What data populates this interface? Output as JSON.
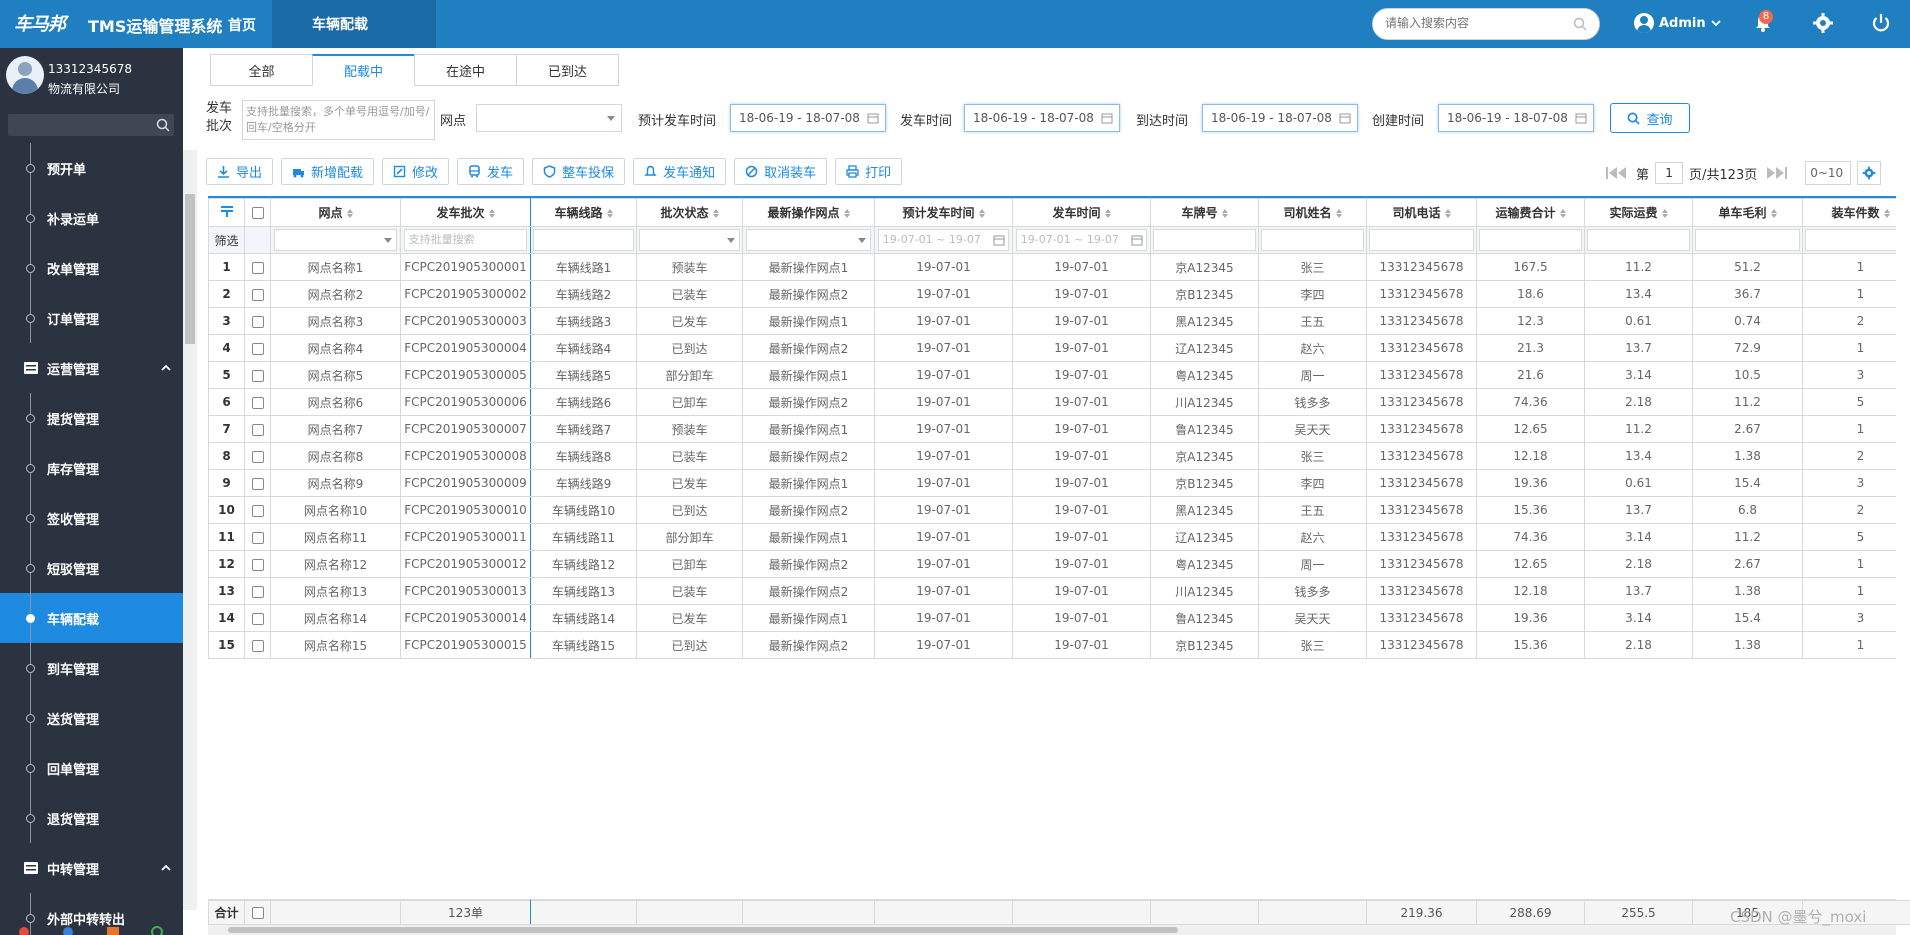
{
  "header": {
    "logo_text": "车马邦",
    "app_title": "TMS运输管理系统",
    "home": "首页",
    "active_tab": "车辆配载",
    "search_placeholder": "请输入搜索内容",
    "user": "Admin",
    "notification_count": "8"
  },
  "sidebar": {
    "phone": "13312345678",
    "company": "物流有限公司",
    "items": [
      {
        "label": "预开单",
        "type": "item"
      },
      {
        "label": "补录运单",
        "type": "item"
      },
      {
        "label": "改单管理",
        "type": "item"
      },
      {
        "label": "订单管理",
        "type": "item"
      },
      {
        "label": "运营管理",
        "type": "group"
      },
      {
        "label": "提货管理",
        "type": "item"
      },
      {
        "label": "库存管理",
        "type": "item"
      },
      {
        "label": "签收管理",
        "type": "item"
      },
      {
        "label": "短驳管理",
        "type": "item"
      },
      {
        "label": "车辆配载",
        "type": "item",
        "active": true
      },
      {
        "label": "到车管理",
        "type": "item"
      },
      {
        "label": "送货管理",
        "type": "item"
      },
      {
        "label": "回单管理",
        "type": "item"
      },
      {
        "label": "退货管理",
        "type": "item"
      },
      {
        "label": "中转管理",
        "type": "group"
      },
      {
        "label": "外部中转转出",
        "type": "item"
      }
    ]
  },
  "tabs": [
    "全部",
    "配载中",
    "在途中",
    "已到达"
  ],
  "active_tab_index": 1,
  "filters": {
    "batch_label": "发车批次",
    "batch_placeholder": "支持批量搜索，多个单号用逗号/加号/回车/空格分开",
    "site_label": "网点",
    "est_depart_label": "预计发车时间",
    "est_depart_value": "18-06-19 - 18-07-08",
    "depart_label": "发车时间",
    "depart_value": "18-06-19 - 18-07-08",
    "arrive_label": "到达时间",
    "arrive_value": "18-06-19 - 18-07-08",
    "create_label": "创建时间",
    "create_value": "18-06-19 - 18-07-08",
    "query_button": "查询"
  },
  "toolbar": [
    "导出",
    "新增配载",
    "修改",
    "发车",
    "整车投保",
    "发车通知",
    "取消装车",
    "打印"
  ],
  "pager": {
    "prefix": "第",
    "page": "1",
    "suffix": "页/共123页",
    "page_size": "0~10"
  },
  "table": {
    "columns": [
      "网点",
      "发车批次",
      "车辆线路",
      "批次状态",
      "最新操作网点",
      "预计发车时间",
      "发车时间",
      "车牌号",
      "司机姓名",
      "司机电话",
      "运输费合计",
      "实际运费",
      "单车毛利",
      "装车件数"
    ],
    "filter_label": "筛选",
    "filter_batch_placeholder": "支持批量搜索",
    "filter_date_placeholder": "19-07-01 ~ 19-07",
    "rows": [
      [
        "1",
        "网点名称1",
        "FCPC201905300001",
        "车辆线路1",
        "预装车",
        "最新操作网点1",
        "19-07-01",
        "19-07-01",
        "京A12345",
        "张三",
        "13312345678",
        "167.5",
        "11.2",
        "51.2",
        "1"
      ],
      [
        "2",
        "网点名称2",
        "FCPC201905300002",
        "车辆线路2",
        "已装车",
        "最新操作网点2",
        "19-07-01",
        "19-07-01",
        "京B12345",
        "李四",
        "13312345678",
        "18.6",
        "13.4",
        "36.7",
        "1"
      ],
      [
        "3",
        "网点名称3",
        "FCPC201905300003",
        "车辆线路3",
        "已发车",
        "最新操作网点1",
        "19-07-01",
        "19-07-01",
        "黑A12345",
        "王五",
        "13312345678",
        "12.3",
        "0.61",
        "0.74",
        "2"
      ],
      [
        "4",
        "网点名称4",
        "FCPC201905300004",
        "车辆线路4",
        "已到达",
        "最新操作网点2",
        "19-07-01",
        "19-07-01",
        "辽A12345",
        "赵六",
        "13312345678",
        "21.3",
        "13.7",
        "72.9",
        "1"
      ],
      [
        "5",
        "网点名称5",
        "FCPC201905300005",
        "车辆线路5",
        "部分卸车",
        "最新操作网点1",
        "19-07-01",
        "19-07-01",
        "粤A12345",
        "周一",
        "13312345678",
        "21.6",
        "3.14",
        "10.5",
        "3"
      ],
      [
        "6",
        "网点名称6",
        "FCPC201905300006",
        "车辆线路6",
        "已卸车",
        "最新操作网点2",
        "19-07-01",
        "19-07-01",
        "川A12345",
        "钱多多",
        "13312345678",
        "74.36",
        "2.18",
        "11.2",
        "5"
      ],
      [
        "7",
        "网点名称7",
        "FCPC201905300007",
        "车辆线路7",
        "预装车",
        "最新操作网点1",
        "19-07-01",
        "19-07-01",
        "鲁A12345",
        "吴天天",
        "13312345678",
        "12.65",
        "11.2",
        "2.67",
        "1"
      ],
      [
        "8",
        "网点名称8",
        "FCPC201905300008",
        "车辆线路8",
        "已装车",
        "最新操作网点2",
        "19-07-01",
        "19-07-01",
        "京A12345",
        "张三",
        "13312345678",
        "12.18",
        "13.4",
        "1.38",
        "2"
      ],
      [
        "9",
        "网点名称9",
        "FCPC201905300009",
        "车辆线路9",
        "已发车",
        "最新操作网点1",
        "19-07-01",
        "19-07-01",
        "京B12345",
        "李四",
        "13312345678",
        "19.36",
        "0.61",
        "15.4",
        "3"
      ],
      [
        "10",
        "网点名称10",
        "FCPC201905300010",
        "车辆线路10",
        "已到达",
        "最新操作网点2",
        "19-07-01",
        "19-07-01",
        "黑A12345",
        "王五",
        "13312345678",
        "15.36",
        "13.7",
        "6.8",
        "2"
      ],
      [
        "11",
        "网点名称11",
        "FCPC201905300011",
        "车辆线路11",
        "部分卸车",
        "最新操作网点1",
        "19-07-01",
        "19-07-01",
        "辽A12345",
        "赵六",
        "13312345678",
        "74.36",
        "3.14",
        "11.2",
        "5"
      ],
      [
        "12",
        "网点名称12",
        "FCPC201905300012",
        "车辆线路12",
        "已卸车",
        "最新操作网点2",
        "19-07-01",
        "19-07-01",
        "粤A12345",
        "周一",
        "13312345678",
        "12.65",
        "2.18",
        "2.67",
        "1"
      ],
      [
        "13",
        "网点名称13",
        "FCPC201905300013",
        "车辆线路13",
        "已装车",
        "最新操作网点2",
        "19-07-01",
        "19-07-01",
        "川A12345",
        "钱多多",
        "13312345678",
        "12.18",
        "13.7",
        "1.38",
        "1"
      ],
      [
        "14",
        "网点名称14",
        "FCPC201905300014",
        "车辆线路14",
        "已发车",
        "最新操作网点1",
        "19-07-01",
        "19-07-01",
        "鲁A12345",
        "吴天天",
        "13312345678",
        "19.36",
        "3.14",
        "15.4",
        "3"
      ],
      [
        "15",
        "网点名称15",
        "FCPC201905300015",
        "车辆线路15",
        "已到达",
        "最新操作网点2",
        "19-07-01",
        "19-07-01",
        "京B12345",
        "张三",
        "13312345678",
        "15.36",
        "2.18",
        "1.38",
        "1"
      ]
    ],
    "footer": {
      "label": "合计",
      "batch_count": "123单",
      "freight_total": "219.36",
      "actual_total": "288.69",
      "profit_total": "255.5",
      "pieces_total": "185"
    }
  },
  "watermark": "CSDN @墨兮_moxi",
  "colors": {
    "primary": "#1e8ae0",
    "header": "#1f7fc1",
    "sidebar": "#2b3240"
  }
}
